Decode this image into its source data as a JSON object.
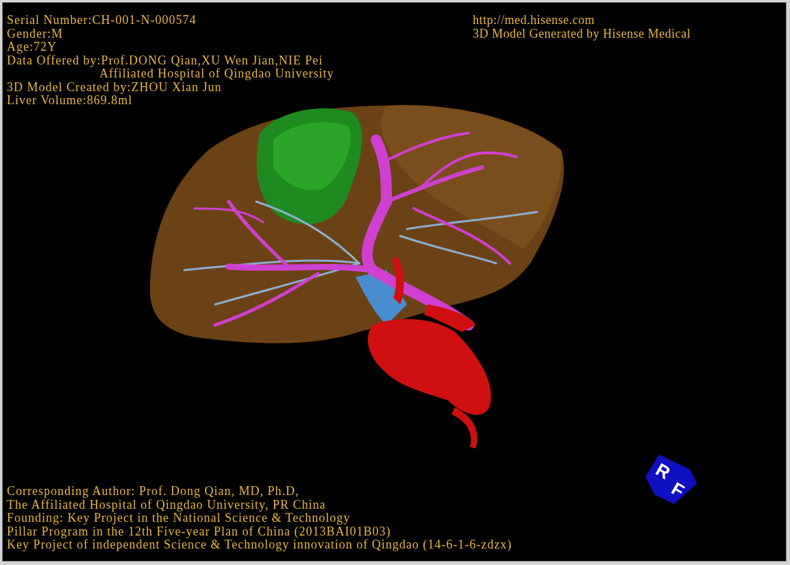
{
  "patient_info": [
    {
      "kind": "line",
      "text": "Serial Number:CH-001-N-000574"
    },
    {
      "kind": "line",
      "text": "Gender:M"
    },
    {
      "kind": "line",
      "text": "Age:72Y"
    },
    {
      "kind": "line",
      "text": "Data Offered by:Prof.DONG Qian,XU Wen Jian,NIE Pei"
    },
    {
      "kind": "continuation",
      "text": "Affiliated Hospital of Qingdao University"
    },
    {
      "kind": "line",
      "text": "3D Model Created by:ZHOU Xian Jun"
    },
    {
      "kind": "line",
      "text": "Liver Volume:869.8ml"
    }
  ],
  "header_right": [
    "http://med.hisense.com",
    "3D Model Generated by Hisense Medical"
  ],
  "footer_lines": [
    "Corresponding Author: Prof. Dong Qian, MD, Ph.D,",
    "The Affiliated Hospital of Qingdao University, PR China",
    "Founding: Key Project in the National Science & Technology",
    "Pillar Program in the 12th Five-year Plan of China (2013BAI01B03)",
    "Key Project of independent Science & Technology innovation of Qingdao (14-6-1-6-zdzx)"
  ],
  "orientation_cube": {
    "labels": [
      "R",
      "F"
    ]
  }
}
